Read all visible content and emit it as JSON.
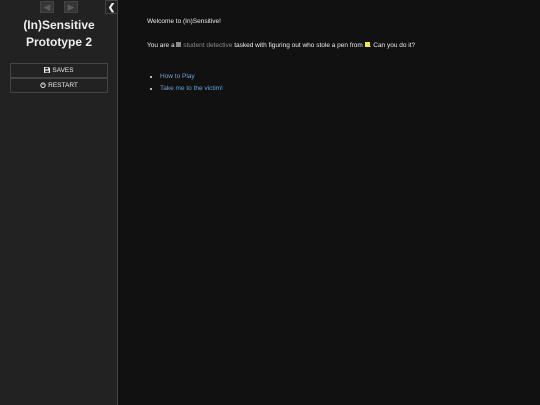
{
  "sidebar": {
    "title_line1": "(In)Sensitive",
    "title_line2": "Prototype 2",
    "saves_label": "SAVES",
    "restart_label": "RESTART",
    "back_icon": "arrow-left-icon",
    "forward_icon": "arrow-right-icon",
    "toggle_icon": "chevron-left-icon"
  },
  "passage": {
    "welcome": "Welcome to (In)Sensitive!",
    "intro_before": "You are a",
    "intro_role": "student detective",
    "intro_middle": "tasked with figuring out who stole a pen from",
    "intro_end": ". Can you do it?",
    "role_swatch_color": "#8a8a8a",
    "victim_swatch_color": "#f5e92a",
    "links": [
      {
        "label": "How to Play"
      },
      {
        "label": "Take me to the victim!"
      }
    ]
  },
  "colors": {
    "background": "#111111",
    "sidebar": "#222222",
    "link": "#68a3d9",
    "text": "#eeeeee"
  }
}
